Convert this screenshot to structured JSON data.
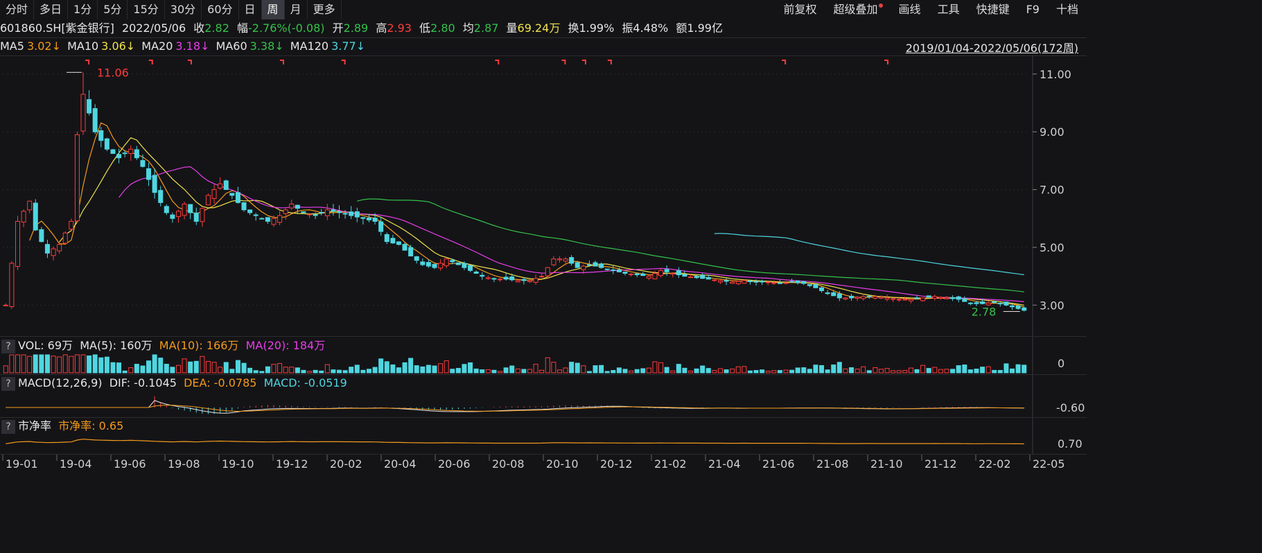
{
  "toolbar": {
    "left": [
      "分时",
      "多日",
      "1分",
      "5分",
      "15分",
      "30分",
      "60分",
      "日",
      "周",
      "月",
      "更多"
    ],
    "active_index": 8,
    "right": [
      "前复权",
      "超级叠加",
      "画线",
      "工具",
      "快捷键",
      "F9",
      "十档"
    ]
  },
  "info": {
    "code_name": "601860.SH[紫金银行]",
    "date": "2022/05/06",
    "close_label": "收",
    "close": "2.82",
    "change_label": "幅",
    "change": "-2.76%(-0.08)",
    "open_label": "开",
    "open": "2.89",
    "high_label": "高",
    "high": "2.93",
    "low_label": "低",
    "low": "2.80",
    "avg_label": "均",
    "avg": "2.87",
    "vol_label": "量",
    "vol": "69.24万",
    "turnover_label": "换",
    "turnover": "1.99%",
    "amplitude_label": "振",
    "amplitude": "4.48%",
    "amount_label": "额",
    "amount": "1.99亿"
  },
  "ma_bar": {
    "ma5_label": "MA5",
    "ma5": "3.02↓",
    "ma10_label": "MA10",
    "ma10": "3.06↓",
    "ma20_label": "MA20",
    "ma20": "3.18↓",
    "ma60_label": "MA60",
    "ma60": "3.38↓",
    "ma120_label": "MA120",
    "ma120": "3.77↓",
    "range": "2019/01/04-2022/05/06(172周)"
  },
  "vol_panel": {
    "q": "?",
    "title": "VOL: 69万",
    "ma5": "MA(5): 160万",
    "ma10": "MA(10): 166万",
    "ma20": "MA(20): 184万",
    "axis": "0"
  },
  "macd_panel": {
    "q": "?",
    "title": "MACD(12,26,9)",
    "dif": "DIF: -0.1045",
    "dea": "DEA: -0.0785",
    "macd": "MACD: -0.0519",
    "axis": "-0.60"
  },
  "pb_panel": {
    "q": "?",
    "title": "市净率",
    "value": "市净率: 0.65",
    "axis": "0.70"
  },
  "chart_data": {
    "type": "candlestick",
    "title": "601860.SH[紫金银行] 周K",
    "y_ticks": [
      "11.00",
      "9.00",
      "7.00",
      "5.00",
      "3.00"
    ],
    "ylim": [
      2.0,
      11.5
    ],
    "x_ticks": [
      "19-01",
      "19-04",
      "19-06",
      "19-08",
      "19-10",
      "19-12",
      "20-02",
      "20-04",
      "20-06",
      "20-08",
      "20-10",
      "20-12",
      "21-02",
      "21-04",
      "21-06",
      "21-08",
      "21-10",
      "21-12",
      "22-02",
      "22-05"
    ],
    "max_label": "11.06",
    "min_label": "2.78",
    "weeks": 172,
    "close_anchors": [
      [
        0,
        3.0
      ],
      [
        2,
        5.9
      ],
      [
        4,
        6.6
      ],
      [
        5,
        5.6
      ],
      [
        7,
        4.8
      ],
      [
        9,
        5.1
      ],
      [
        11,
        5.9
      ],
      [
        12,
        8.9
      ],
      [
        13,
        10.3
      ],
      [
        15,
        9.0
      ],
      [
        17,
        8.4
      ],
      [
        19,
        8.1
      ],
      [
        21,
        8.4
      ],
      [
        23,
        7.8
      ],
      [
        25,
        6.9
      ],
      [
        27,
        6.2
      ],
      [
        28,
        6.0
      ],
      [
        30,
        6.5
      ],
      [
        32,
        5.9
      ],
      [
        34,
        6.8
      ],
      [
        36,
        7.2
      ],
      [
        38,
        6.8
      ],
      [
        40,
        6.3
      ],
      [
        42,
        6.1
      ],
      [
        44,
        5.9
      ],
      [
        46,
        6.1
      ],
      [
        48,
        6.5
      ],
      [
        50,
        6.2
      ],
      [
        52,
        6.1
      ],
      [
        54,
        6.3
      ],
      [
        56,
        6.2
      ],
      [
        58,
        6.1
      ],
      [
        60,
        6.0
      ],
      [
        62,
        5.9
      ],
      [
        64,
        5.2
      ],
      [
        66,
        5.1
      ],
      [
        68,
        4.7
      ],
      [
        70,
        4.4
      ],
      [
        72,
        4.3
      ],
      [
        74,
        4.6
      ],
      [
        76,
        4.4
      ],
      [
        78,
        4.2
      ],
      [
        80,
        4.0
      ],
      [
        82,
        3.9
      ],
      [
        84,
        3.9
      ],
      [
        86,
        3.85
      ],
      [
        88,
        3.85
      ],
      [
        90,
        4.0
      ],
      [
        92,
        4.6
      ],
      [
        94,
        4.6
      ],
      [
        96,
        4.3
      ],
      [
        98,
        4.4
      ],
      [
        100,
        4.3
      ],
      [
        102,
        4.2
      ],
      [
        104,
        4.1
      ],
      [
        106,
        4.05
      ],
      [
        108,
        4.0
      ],
      [
        110,
        4.2
      ],
      [
        112,
        4.1
      ],
      [
        114,
        4.0
      ],
      [
        116,
        3.95
      ],
      [
        118,
        3.9
      ],
      [
        120,
        3.85
      ],
      [
        122,
        3.8
      ],
      [
        124,
        3.85
      ],
      [
        126,
        3.8
      ],
      [
        128,
        3.8
      ],
      [
        130,
        3.75
      ],
      [
        132,
        3.8
      ],
      [
        134,
        3.75
      ],
      [
        136,
        3.6
      ],
      [
        138,
        3.4
      ],
      [
        140,
        3.25
      ],
      [
        142,
        3.25
      ],
      [
        144,
        3.3
      ],
      [
        146,
        3.3
      ],
      [
        148,
        3.25
      ],
      [
        150,
        3.2
      ],
      [
        152,
        3.2
      ],
      [
        154,
        3.25
      ],
      [
        156,
        3.3
      ],
      [
        158,
        3.25
      ],
      [
        160,
        3.2
      ],
      [
        162,
        3.05
      ],
      [
        164,
        3.05
      ],
      [
        166,
        3.1
      ],
      [
        168,
        3.0
      ],
      [
        171,
        2.82
      ]
    ],
    "series": [
      {
        "name": "MA5",
        "color": "#f59a1a"
      },
      {
        "name": "MA10",
        "color": "#f2e34c"
      },
      {
        "name": "MA20",
        "color": "#e83ee8"
      },
      {
        "name": "MA60",
        "color": "#35c24a"
      },
      {
        "name": "MA120",
        "color": "#4fd6e0"
      }
    ],
    "colors": {
      "up": "#ff3b3b",
      "down": "#4fd6e0",
      "axis": "#d0d0d0",
      "grid": "#2a2a2e"
    }
  }
}
